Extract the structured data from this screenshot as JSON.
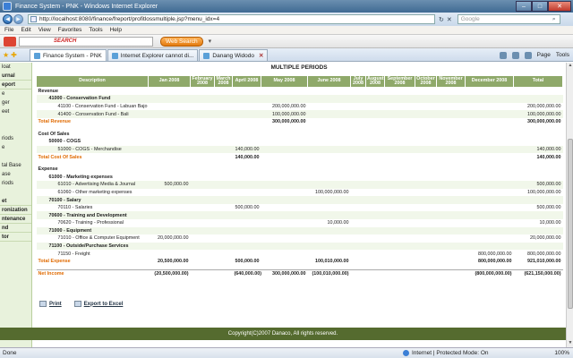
{
  "window": {
    "title": "Finance System - PNK - Windows Internet Explorer",
    "min": "–",
    "max": "□",
    "close": "✕"
  },
  "address": {
    "url": "http://localhost:8080/finance/freport/profitlossmultiple.jsp?menu_idx=4",
    "search_placeholder": "Google"
  },
  "menu": [
    "File",
    "Edit",
    "View",
    "Favorites",
    "Tools",
    "Help"
  ],
  "yahoo": {
    "search_label": "SEARCH",
    "web_search": "Web Search"
  },
  "tabs": [
    {
      "label": "Finance System - PNK",
      "active": true
    },
    {
      "label": "Internet Explorer cannot di...",
      "active": false
    },
    {
      "label": "Danang Widodo",
      "active": false
    }
  ],
  "tab_tools": {
    "page": "Page",
    "tools": "Tools"
  },
  "sidebar": [
    {
      "label": "loat",
      "bold": false
    },
    {
      "label": "urnal",
      "bold": true
    },
    {
      "label": "eport",
      "bold": true
    },
    {
      "label": "e",
      "bold": false
    },
    {
      "label": "ger",
      "bold": false
    },
    {
      "label": "eet",
      "bold": false
    },
    {
      "label": "",
      "bold": false
    },
    {
      "label": "",
      "bold": false
    },
    {
      "label": "riods",
      "bold": false
    },
    {
      "label": "e",
      "bold": false
    },
    {
      "label": "",
      "bold": false
    },
    {
      "label": "tal Base",
      "bold": false
    },
    {
      "label": "ase",
      "bold": false
    },
    {
      "label": "riods",
      "bold": false
    },
    {
      "label": "",
      "bold": false
    },
    {
      "label": "et",
      "bold": true
    },
    {
      "label": "ronization",
      "bold": true
    },
    {
      "label": "ntenance",
      "bold": true
    },
    {
      "label": "nd",
      "bold": true
    },
    {
      "label": "tor",
      "bold": true
    }
  ],
  "report": {
    "title": "MULTIPLE PERIODS",
    "columns": [
      "Description",
      "Jan 2008",
      "February 2008",
      "March 2008",
      "April 2008",
      "May 2008",
      "June 2008",
      "July 2008",
      "August 2008",
      "September 2008",
      "October 2008",
      "November 2008",
      "December 2008",
      "Total"
    ],
    "rows": [
      {
        "type": "sec",
        "cells": [
          "Revenue",
          "",
          "",
          "",
          "",
          "",
          "",
          "",
          "",
          "",
          "",
          "",
          "",
          ""
        ]
      },
      {
        "type": "acct",
        "cells": [
          "41000 - Conservation Fund",
          "",
          "",
          "",
          "",
          "",
          "",
          "",
          "",
          "",
          "",
          "",
          "",
          ""
        ]
      },
      {
        "type": "sub",
        "cells": [
          "41100 - Conservation Fund - Labuan Bajo",
          "",
          "",
          "",
          "",
          "200,000,000.00",
          "",
          "",
          "",
          "",
          "",
          "",
          "",
          "200,000,000.00"
        ]
      },
      {
        "type": "sub",
        "cells": [
          "41400 - Conservation Fund - Bali",
          "",
          "",
          "",
          "",
          "100,000,000.00",
          "",
          "",
          "",
          "",
          "",
          "",
          "",
          "100,000,000.00"
        ]
      },
      {
        "type": "total",
        "cells": [
          "Total Revenue",
          "",
          "",
          "",
          "",
          "300,000,000.00",
          "",
          "",
          "",
          "",
          "",
          "",
          "",
          "300,000,000.00"
        ]
      },
      {
        "type": "gap",
        "cells": [
          "",
          "",
          "",
          "",
          "",
          "",
          "",
          "",
          "",
          "",
          "",
          "",
          "",
          ""
        ]
      },
      {
        "type": "sec",
        "cells": [
          "Cost Of Sales",
          "",
          "",
          "",
          "",
          "",
          "",
          "",
          "",
          "",
          "",
          "",
          "",
          ""
        ]
      },
      {
        "type": "acct",
        "cells": [
          "50000 - COGS",
          "",
          "",
          "",
          "",
          "",
          "",
          "",
          "",
          "",
          "",
          "",
          "",
          ""
        ]
      },
      {
        "type": "sub",
        "cells": [
          "51000 - COGS - Merchandise",
          "",
          "",
          "",
          "140,000.00",
          "",
          "",
          "",
          "",
          "",
          "",
          "",
          "",
          "140,000.00"
        ]
      },
      {
        "type": "total",
        "cells": [
          "Total Cost Of Sales",
          "",
          "",
          "",
          "140,000.00",
          "",
          "",
          "",
          "",
          "",
          "",
          "",
          "",
          "140,000.00"
        ]
      },
      {
        "type": "gap",
        "cells": [
          "",
          "",
          "",
          "",
          "",
          "",
          "",
          "",
          "",
          "",
          "",
          "",
          "",
          ""
        ]
      },
      {
        "type": "sec",
        "cells": [
          "Expense",
          "",
          "",
          "",
          "",
          "",
          "",
          "",
          "",
          "",
          "",
          "",
          "",
          ""
        ]
      },
      {
        "type": "acct",
        "cells": [
          "61000 - Marketing expenses",
          "",
          "",
          "",
          "",
          "",
          "",
          "",
          "",
          "",
          "",
          "",
          "",
          ""
        ]
      },
      {
        "type": "sub",
        "cells": [
          "61010 - Advertising Media & Journal",
          "500,000.00",
          "",
          "",
          "",
          "",
          "",
          "",
          "",
          "",
          "",
          "",
          "",
          "500,000.00"
        ]
      },
      {
        "type": "sub",
        "cells": [
          "61060 - Other marketing expenses",
          "",
          "",
          "",
          "",
          "",
          "100,000,000.00",
          "",
          "",
          "",
          "",
          "",
          "",
          "100,000,000.00"
        ]
      },
      {
        "type": "acct",
        "cells": [
          "70100 - Salary",
          "",
          "",
          "",
          "",
          "",
          "",
          "",
          "",
          "",
          "",
          "",
          "",
          ""
        ]
      },
      {
        "type": "sub",
        "cells": [
          "70110 - Salaries",
          "",
          "",
          "",
          "500,000.00",
          "",
          "",
          "",
          "",
          "",
          "",
          "",
          "",
          "500,000.00"
        ]
      },
      {
        "type": "acct",
        "cells": [
          "70600 - Training and Development",
          "",
          "",
          "",
          "",
          "",
          "",
          "",
          "",
          "",
          "",
          "",
          "",
          ""
        ]
      },
      {
        "type": "sub",
        "cells": [
          "70620 - Training - Professional",
          "",
          "",
          "",
          "",
          "",
          "10,000.00",
          "",
          "",
          "",
          "",
          "",
          "",
          "10,000.00"
        ]
      },
      {
        "type": "acct",
        "cells": [
          "71000 - Equipment",
          "",
          "",
          "",
          "",
          "",
          "",
          "",
          "",
          "",
          "",
          "",
          "",
          ""
        ]
      },
      {
        "type": "sub",
        "cells": [
          "71010 - Office & Computer Equipment",
          "20,000,000.00",
          "",
          "",
          "",
          "",
          "",
          "",
          "",
          "",
          "",
          "",
          "",
          "20,000,000.00"
        ]
      },
      {
        "type": "acct",
        "cells": [
          "71100 - Outside/Purchase Services",
          "",
          "",
          "",
          "",
          "",
          "",
          "",
          "",
          "",
          "",
          "",
          "",
          ""
        ]
      },
      {
        "type": "sub",
        "cells": [
          "71150 - Freight",
          "",
          "",
          "",
          "",
          "",
          "",
          "",
          "",
          "",
          "",
          "",
          "800,000,000.00",
          "800,000,000.00"
        ]
      },
      {
        "type": "total",
        "cells": [
          "Total Expense",
          "20,500,000.00",
          "",
          "",
          "500,000.00",
          "",
          "100,010,000.00",
          "",
          "",
          "",
          "",
          "",
          "800,000,000.00",
          "921,010,000.00"
        ]
      },
      {
        "type": "gap",
        "cells": [
          "",
          "",
          "",
          "",
          "",
          "",
          "",
          "",
          "",
          "",
          "",
          "",
          "",
          ""
        ]
      },
      {
        "type": "net",
        "cells": [
          "Net Income",
          "(20,500,000.00)",
          "",
          "",
          "(640,000.00)",
          "300,000,000.00",
          "(100,010,000.00)",
          "",
          "",
          "",
          "",
          "",
          "(800,000,000.00)",
          "(621,150,000.00)"
        ]
      }
    ]
  },
  "actions": {
    "print": "Print",
    "export": "Export to Excel"
  },
  "footer": "Copyright(C)2007 Danaco, All rights reserved.",
  "status": {
    "left": "Done",
    "zone": "Internet | Protected Mode: On",
    "zoom": "100%"
  },
  "colors": {
    "header_bg": "#8fa96a",
    "total_text": "#e06a00",
    "footer_bg": "#556b2f"
  }
}
